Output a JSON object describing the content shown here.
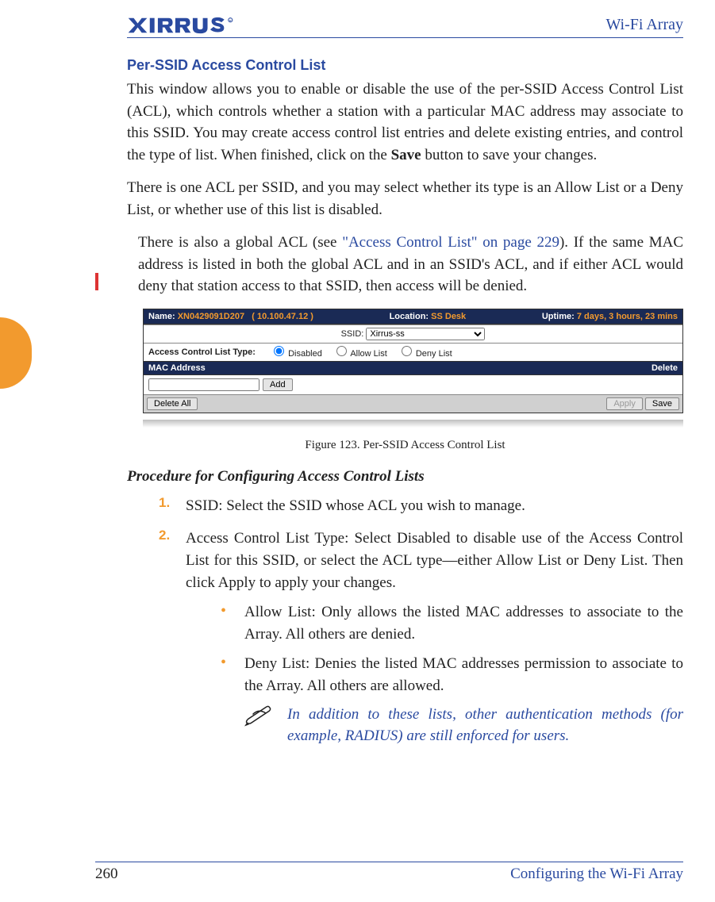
{
  "header": {
    "product": "Wi-Fi Array"
  },
  "section_title": "Per-SSID Access Control List",
  "para1_a": "This window allows you to enable or disable the use of the per-SSID Access Control List (ACL), which controls whether a station with a particular MAC address may associate to this SSID. You may create access control list entries and delete existing entries, and control the type of list. When finished, click on the ",
  "para1_bold": "Save",
  "para1_b": " button to save your changes.",
  "para2": "There is one ACL per SSID, and you may select whether its type is an Allow List or a Deny List, or whether use of this list is disabled.",
  "para3_a": "There is also a global ACL (see ",
  "para3_link": "\"Access Control List\" on page 229",
  "para3_b": "). If the same MAC address is listed in both the global ACL and in an SSID's ACL, and if either ACL would deny that station access to that SSID, then access will be denied.",
  "screenshot": {
    "name_label": "Name:",
    "name_value": "XN0429091D207",
    "ip_value": "( 10.100.47.12 )",
    "location_label": "Location:",
    "location_value": "SS Desk",
    "uptime_label": "Uptime:",
    "uptime_value": "7 days, 3 hours, 23 mins",
    "ssid_label": "SSID:",
    "ssid_value": "Xirrus-ss",
    "acl_type_label": "Access Control List Type:",
    "radio_disabled": "Disabled",
    "radio_allow": "Allow List",
    "radio_deny": "Deny List",
    "col_mac": "MAC Address",
    "col_delete": "Delete",
    "btn_add": "Add",
    "btn_delete_all": "Delete All",
    "btn_apply": "Apply",
    "btn_save": "Save"
  },
  "figure_caption": "Figure 123. Per-SSID Access Control List",
  "procedure_heading": "Procedure for Configuring Access Control Lists",
  "steps": [
    {
      "num": "1.",
      "bold": "SSID",
      "rest": ": Select the SSID whose ACL you wish to manage."
    },
    {
      "num": "2.",
      "bold": "Access Control List Type",
      "rest": ": Select Disabled to disable use of the Access Control List for this SSID, or select the ACL type—either Allow List or Deny List. Then click Apply to apply your changes."
    }
  ],
  "bullets": [
    {
      "bold": "Allow List",
      "rest": ": Only allows the listed MAC addresses to associate to the Array. All others are denied."
    },
    {
      "bold": "Deny List",
      "rest": ": Denies the listed MAC addresses permission to associate to the Array. All others are allowed."
    }
  ],
  "note": "In addition to these lists, other authentication methods (for example, RADIUS) are still enforced for users.",
  "footer": {
    "page": "260",
    "section": "Configuring the Wi-Fi Array"
  }
}
